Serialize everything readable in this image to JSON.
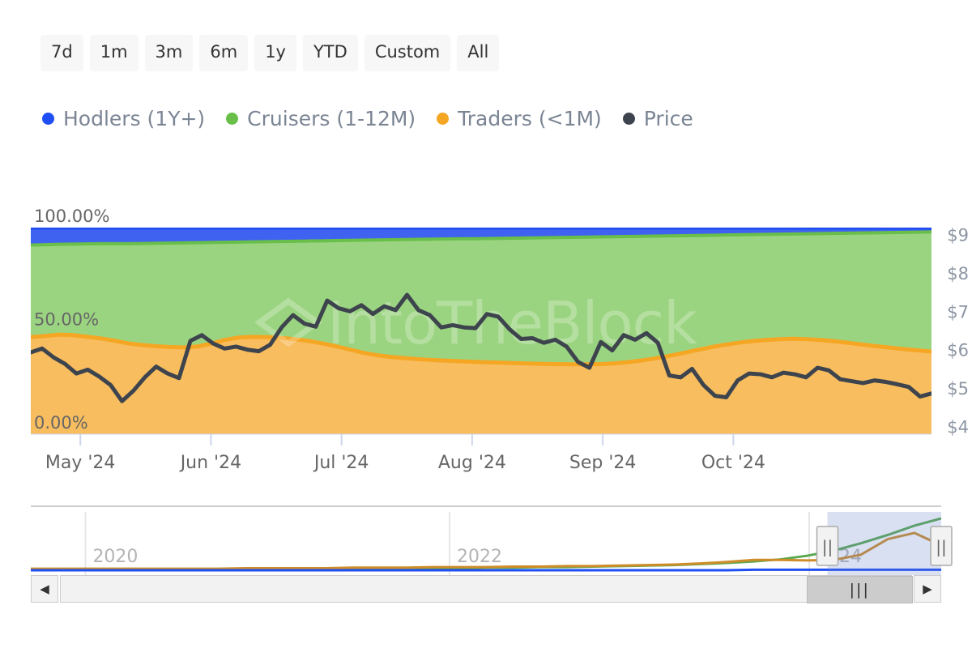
{
  "range_selector": {
    "buttons": [
      {
        "label": "7d",
        "selected": false
      },
      {
        "label": "1m",
        "selected": false
      },
      {
        "label": "3m",
        "selected": false
      },
      {
        "label": "6m",
        "selected": false
      },
      {
        "label": "1y",
        "selected": false
      },
      {
        "label": "YTD",
        "selected": false
      },
      {
        "label": "Custom",
        "selected": false
      },
      {
        "label": "All",
        "selected": false
      }
    ]
  },
  "legend": {
    "items": [
      {
        "label": "Hodlers (1Y+)",
        "color": "#1f4ef5"
      },
      {
        "label": "Cruisers (1-12M)",
        "color": "#69bf4a"
      },
      {
        "label": "Traders (<1M)",
        "color": "#f5a623"
      },
      {
        "label": "Price",
        "color": "#3d444d"
      }
    ]
  },
  "watermark": {
    "text": "IntoTheBlock"
  },
  "chart_data": {
    "type": "area",
    "title": "",
    "subtitle": "",
    "stacked": true,
    "stack_mode": "percent",
    "xlabel": "",
    "ylabel": "",
    "y_left": {
      "ticks": [
        "0.00%",
        "50.00%",
        "100.00%"
      ],
      "tick_values": [
        0,
        50,
        100
      ],
      "ylim": [
        0,
        100
      ]
    },
    "y_right": {
      "ticks": [
        "$4",
        "$5",
        "$6",
        "$7",
        "$8",
        "$9"
      ],
      "tick_values": [
        4,
        5,
        6,
        7,
        8,
        9
      ],
      "ylim": [
        3.82,
        9.2
      ],
      "label": "Price"
    },
    "x_ticks": [
      "May '24",
      "Jun '24",
      "Jul '24",
      "Aug '24",
      "Sep '24",
      "Oct '24"
    ],
    "x_tick_positions": [
      0.055,
      0.2,
      0.345,
      0.49,
      0.635,
      0.78
    ],
    "grid": true,
    "legend_position": "top-left",
    "series": [
      {
        "name": "Traders (<1M)",
        "color": "#f5a623",
        "fill": "#f7bd5f",
        "unit": "percent_of_supply",
        "values": [
          47.0,
          47.5,
          48.2,
          48.0,
          47.2,
          46.4,
          45.3,
          44.0,
          43.2,
          42.6,
          42.2,
          42.0,
          42.4,
          43.8,
          45.6,
          46.8,
          47.1,
          47.0,
          46.6,
          46.0,
          45.2,
          44.0,
          42.6,
          41.0,
          39.4,
          38.2,
          37.4,
          36.8,
          36.3,
          35.9,
          35.6,
          35.3,
          35.0,
          34.8,
          34.6,
          34.4,
          34.2,
          34.0,
          33.9,
          33.8,
          33.8,
          33.9,
          34.2,
          34.8,
          35.6,
          36.6,
          37.8,
          39.2,
          40.6,
          42.0,
          43.2,
          44.2,
          45.0,
          45.6,
          46.0,
          46.2,
          46.0,
          45.6,
          45.0,
          44.2,
          43.4,
          42.6,
          41.9,
          41.2,
          40.6,
          40.0
        ]
      },
      {
        "name": "Cruisers (1-12M)",
        "color": "#69bf4a",
        "fill": "#9bd481",
        "unit": "percent_of_supply",
        "values": [
          44.5,
          44.2,
          43.7,
          44.0,
          44.9,
          45.8,
          46.9,
          48.2,
          49.1,
          49.8,
          50.3,
          50.6,
          50.3,
          49.0,
          47.3,
          46.2,
          46.0,
          46.2,
          46.7,
          47.4,
          48.3,
          49.6,
          51.1,
          52.8,
          54.5,
          55.8,
          56.7,
          57.4,
          58.0,
          58.5,
          58.9,
          59.3,
          59.6,
          59.9,
          60.2,
          60.5,
          60.8,
          61.1,
          61.3,
          61.5,
          61.6,
          61.6,
          61.4,
          60.9,
          60.2,
          59.3,
          58.2,
          56.9,
          55.6,
          54.3,
          53.2,
          52.3,
          51.6,
          51.1,
          50.8,
          50.7,
          51.0,
          51.5,
          52.2,
          53.1,
          54.0,
          54.9,
          55.7,
          56.5,
          57.2,
          57.9
        ]
      },
      {
        "name": "Hodlers (1Y+)",
        "color": "#1f4ef5",
        "fill": "#3f62f0",
        "unit": "percent_of_supply",
        "values": [
          8.5,
          8.3,
          8.1,
          8.0,
          7.9,
          7.8,
          7.8,
          7.8,
          7.7,
          7.6,
          7.5,
          7.4,
          7.3,
          7.2,
          7.1,
          7.0,
          6.9,
          6.8,
          6.7,
          6.6,
          6.5,
          6.4,
          6.3,
          6.2,
          6.1,
          6.0,
          5.9,
          5.8,
          5.7,
          5.6,
          5.5,
          5.4,
          5.4,
          5.3,
          5.2,
          5.1,
          5.0,
          4.9,
          4.8,
          4.7,
          4.6,
          4.5,
          4.4,
          4.3,
          4.2,
          4.1,
          4.0,
          3.9,
          3.8,
          3.7,
          3.6,
          3.5,
          3.4,
          3.3,
          3.2,
          3.1,
          3.0,
          2.9,
          2.8,
          2.7,
          2.6,
          2.5,
          2.4,
          2.3,
          2.2,
          2.1
        ]
      },
      {
        "name": "Price",
        "color": "#3d444d",
        "axis": "right",
        "unit": "usd",
        "values": [
          5.95,
          6.05,
          5.82,
          5.65,
          5.4,
          5.5,
          5.32,
          5.1,
          4.68,
          4.95,
          5.3,
          5.58,
          5.4,
          5.28,
          6.25,
          6.4,
          6.18,
          6.05,
          6.1,
          6.02,
          5.98,
          6.15,
          6.6,
          6.92,
          6.7,
          6.62,
          7.3,
          7.1,
          7.02,
          7.18,
          6.95,
          7.15,
          7.05,
          7.45,
          7.05,
          6.92,
          6.6,
          6.66,
          6.6,
          6.58,
          6.95,
          6.88,
          6.55,
          6.3,
          6.32,
          6.2,
          6.28,
          6.1,
          5.7,
          5.55,
          6.22,
          6.0,
          6.4,
          6.28,
          6.45,
          6.2,
          5.35,
          5.3,
          5.52,
          5.1,
          4.82,
          4.78,
          5.22,
          5.4,
          5.38,
          5.3,
          5.42,
          5.38,
          5.3,
          5.55,
          5.48,
          5.25,
          5.2,
          5.15,
          5.22,
          5.18,
          5.12,
          5.05,
          4.8,
          4.88
        ]
      }
    ]
  },
  "navigator": {
    "year_labels": [
      "2020",
      "2022",
      "2024"
    ],
    "year_positions": [
      0.06,
      0.46,
      0.855
    ],
    "selected_range_start": 0.875,
    "selected_range_end": 1.0,
    "handle_left_grip": "||",
    "handle_right_grip": "||",
    "series": [
      {
        "name": "Cruisers (1-12M)",
        "color": "#5aa84f",
        "values": [
          0.02,
          0.02,
          0.02,
          0.02,
          0.02,
          0.02,
          0.02,
          0.02,
          0.02,
          0.03,
          0.03,
          0.03,
          0.03,
          0.03,
          0.04,
          0.04,
          0.04,
          0.05,
          0.05,
          0.06,
          0.06,
          0.07,
          0.08,
          0.09,
          0.1,
          0.12,
          0.14,
          0.17,
          0.21,
          0.28,
          0.38,
          0.52,
          0.68,
          0.86,
          1.0
        ]
      },
      {
        "name": "Traders (<1M)",
        "color": "#cf8d29",
        "values": [
          0.03,
          0.03,
          0.03,
          0.03,
          0.03,
          0.03,
          0.03,
          0.03,
          0.04,
          0.04,
          0.04,
          0.04,
          0.05,
          0.05,
          0.05,
          0.06,
          0.06,
          0.06,
          0.07,
          0.07,
          0.08,
          0.08,
          0.09,
          0.1,
          0.11,
          0.13,
          0.16,
          0.2,
          0.2,
          0.19,
          0.2,
          0.3,
          0.6,
          0.72,
          0.48
        ]
      },
      {
        "name": "Hodlers (1Y+)",
        "color": "#1f4ef5",
        "values": [
          0.0,
          0.0,
          0.0,
          0.0,
          0.0,
          0.0,
          0.0,
          0.0,
          0.0,
          0.0,
          0.0,
          0.0,
          0.0,
          0.0,
          0.0,
          0.0,
          0.0,
          0.0,
          0.0,
          0.0,
          0.0,
          0.0,
          0.0,
          0.0,
          0.0,
          0.0,
          0.0,
          0.01,
          0.01,
          0.01,
          0.01,
          0.01,
          0.01,
          0.01,
          0.01
        ]
      }
    ],
    "scrollbar": {
      "left_arrow": "◀",
      "right_arrow": "▶",
      "thumb_grip": "|||",
      "thumb_start": 0.875,
      "thumb_end": 1.0
    }
  }
}
